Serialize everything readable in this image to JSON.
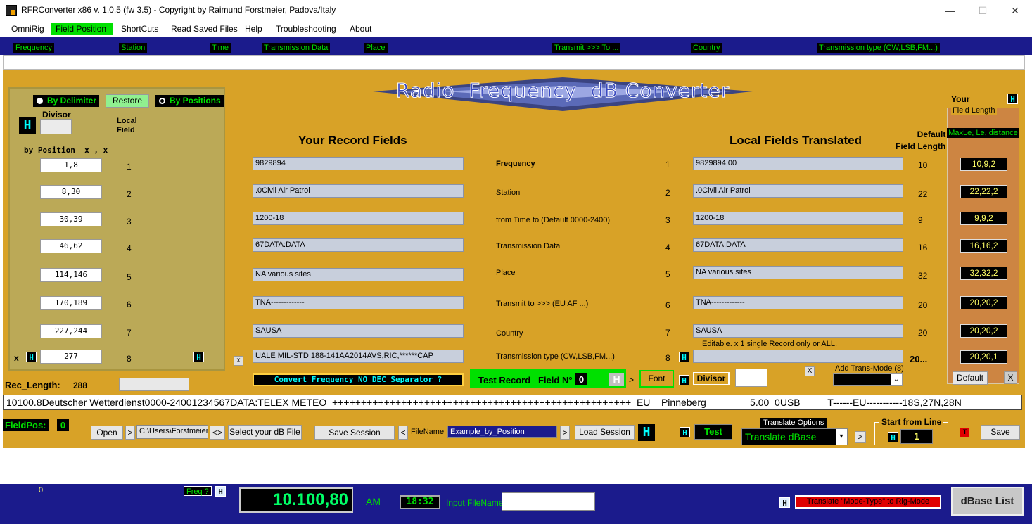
{
  "window": {
    "title": "RFRConverter x86 v. 1.0.5 (fw 3.5) - Copyright by Raimund Forstmeier, Padova/Italy",
    "minimize": "—",
    "maximize": "☐",
    "close": "✕"
  },
  "menu": [
    "OmniRig",
    "Field Position",
    "ShortCuts",
    "Read Saved Files",
    "Help",
    "Troubleshooting",
    "About"
  ],
  "field_tags": [
    "Frequency",
    "Station",
    "Time",
    "Transmission Data",
    "Place",
    "Transmit >>> To ...",
    "Country",
    "Transmission type (CW,LSB,FM...)"
  ],
  "banner": "Radio  Frequency  dB Converter",
  "left": {
    "by_delimiter": "By Delimiter",
    "restore": "Restore",
    "by_positions": "By Positions",
    "divisor_label": "Divisor",
    "h": "H",
    "local_field": "Local\nField",
    "by_position_hdr": "by Position  x , x",
    "positions": [
      "1,8",
      "8,30",
      "30,39",
      "46,62",
      "114,146",
      "170,189",
      "227,244",
      "277"
    ],
    "indices": [
      "1",
      "2",
      "3",
      "4",
      "5",
      "6",
      "7",
      "8"
    ],
    "x": "x"
  },
  "headers": {
    "your_record": "Your Record Fields",
    "local_translated": "Local Fields Translated",
    "default_len": "Default\nField Length",
    "your": "Your",
    "field_length": "Field Length",
    "maxle": "MaxLe, Le, distance"
  },
  "record_fields": [
    "9829894",
    ".0Civil Air Patrol",
    "1200-18",
    "67DATA:DATA",
    "NA    various sites",
    "TNA-------------",
    "SAUSA",
    "UALE MIL-STD 188-141AA2014AVS,RIC,******CAP"
  ],
  "field_names": [
    "Frequency",
    "Station",
    "from Time to (Default 0000-2400)",
    "Transmission Data",
    "Place",
    "Transmit to >>> (EU AF ...)",
    "Country",
    "Transmission type (CW,LSB,FM...)"
  ],
  "field_nums": [
    "1",
    "2",
    "3",
    "4",
    "5",
    "6",
    "7",
    "8"
  ],
  "local_fields": [
    "9829894.00",
    ".0Civil Air Patrol",
    "1200-18",
    "67DATA:DATA",
    "NA    various sites",
    "TNA-------------",
    "SAUSA",
    ""
  ],
  "default_lengths": [
    "10",
    "22",
    "9",
    "16",
    "32",
    "20",
    "20",
    "20..."
  ],
  "maxle_values": [
    "10,9,2",
    "22,22,2",
    "9,9,2",
    "16,16,2",
    "32,32,2",
    "20,20,2",
    "20,20,2",
    "20,20,1"
  ],
  "editable_note": "Editable. x 1 single Record only or ALL.",
  "controls": {
    "convert_freq": "Convert Frequency NO DEC Separator ?",
    "test_record": "Test Record",
    "field_n": "Field N°",
    "field_n_value": "0",
    "font": "Font",
    "divisor": "Divisor",
    "add_trans_mode": "Add Trans-Mode (8)",
    "default": "Default",
    "x": "X",
    "gt": ">",
    "rec_length_label": "Rec_Length:",
    "rec_length_value": "288"
  },
  "output_line": "10100.8Deutscher Wetterdienst0000-24001234567DATA:TELEX METEO  ++++++++++++++++++++++++++++++++++++++++++++++++++++  EU    Pinneberg                5.00  0USB          T------EU-----------18S,27N,28N",
  "bottom": {
    "fieldpos": "FieldPos:",
    "fieldpos_value": "0",
    "open": "Open",
    "path": "C:\\Users\\Forstmeier",
    "swap": "<>",
    "select_db": "Select your dB File",
    "save_session": "Save Session",
    "lt": "<",
    "filename_label": "FileName",
    "filename_value": "Example_by_Position",
    "load_session": "Load Session",
    "test": "Test",
    "translate_options": "Translate Options",
    "translate_value": "Translate dBase",
    "start_from_line": "Start from Line",
    "start_value": "1",
    "t": "T",
    "save": "Save"
  },
  "status": {
    "zero": "0",
    "freq_q": "Freq ?",
    "freq_display": "10.100,80",
    "mode": "AM",
    "time": "18:32",
    "input_filename": "Input FileName",
    "translate_mode": "Translate \"Mode-Type\" to Rig-Mode",
    "dbase_list": "dBase List"
  }
}
